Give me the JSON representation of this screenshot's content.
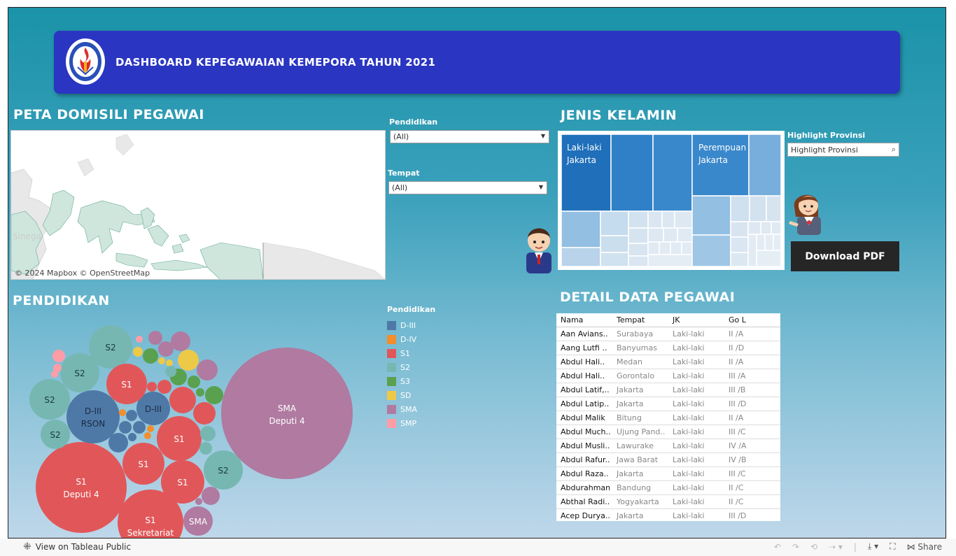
{
  "banner": {
    "title": "DASHBOARD KEPEGAWAIAN KEMEPORA TAHUN 2021",
    "logo_text": "KEMENTERIAN PEMUDA DAN OLAHRAGA REPUBLIK INDONESIA"
  },
  "map_section": {
    "title": "PETA DOMISILI PEGAWAI",
    "credit": "© 2024 Mapbox  © OpenStreetMap",
    "faint_label": "Sinega"
  },
  "filters": {
    "pendidikan": {
      "label": "Pendidikan",
      "value": "(All)"
    },
    "tempat": {
      "label": "Tempat",
      "value": "(All)"
    }
  },
  "gender_section": {
    "title": "JENIS KELAMIN",
    "male_label_1": "Laki-laki",
    "male_label_2": "Jakarta",
    "female_label_1": "Perempuan",
    "female_label_2": "Jakarta"
  },
  "highlight": {
    "label": "Highlight Provinsi",
    "placeholder": "Highlight Provinsi"
  },
  "download_button": "Download PDF",
  "pendidikan_section": {
    "title": "PENDIDIKAN"
  },
  "legend": {
    "title": "Pendidikan",
    "items": [
      {
        "label": "D-III",
        "color": "#4e79a7"
      },
      {
        "label": "D-IV",
        "color": "#f28e2b"
      },
      {
        "label": "S1",
        "color": "#e15759"
      },
      {
        "label": "S2",
        "color": "#76b7b2"
      },
      {
        "label": "S3",
        "color": "#59a14f"
      },
      {
        "label": "SD",
        "color": "#edc948"
      },
      {
        "label": "SMA",
        "color": "#b07aa1"
      },
      {
        "label": "SMP",
        "color": "#ff9da7"
      }
    ]
  },
  "bubble_labels": {
    "sma_big_1": "SMA",
    "sma_big_2": "Deputi 4",
    "s1_big_1": "S1",
    "s1_big_2": "Deputi 4",
    "s1_sek_1": "S1",
    "s1_sek_2": "Sekretariat",
    "d3_rson_1": "D-III",
    "d3_rson_2": "RSON",
    "d3": "D-III",
    "s2": "S2",
    "s1": "S1",
    "sma": "SMA"
  },
  "detail_section": {
    "title": "DETAIL DATA PEGAWAI",
    "columns": [
      "Nama",
      "Tempat",
      "JK",
      "Go L"
    ],
    "rows": [
      [
        "Aan Avians..",
        "Surabaya",
        "Laki-laki",
        "II /A"
      ],
      [
        "Aang Lutfi ..",
        "Banyumas",
        "Laki-laki",
        "II /D"
      ],
      [
        "Abdul Hali..",
        "Medan",
        "Laki-laki",
        "II /A"
      ],
      [
        "Abdul Hali..",
        "Gorontalo",
        "Laki-laki",
        "III /A"
      ],
      [
        "Abdul Latif,..",
        "Jakarta",
        "Laki-laki",
        "III /B"
      ],
      [
        "Abdul Latip..",
        "Jakarta",
        "Laki-laki",
        "III /D"
      ],
      [
        "Abdul Malik",
        "Bitung",
        "Laki-laki",
        "II /A"
      ],
      [
        "Abdul Much..",
        "Ujung Pand..",
        "Laki-laki",
        "III /C"
      ],
      [
        "Abdul Musli..",
        "Lawurake",
        "Laki-laki",
        "IV /A"
      ],
      [
        "Abdul Rafur..",
        "Jawa Barat",
        "Laki-laki",
        "IV /B"
      ],
      [
        "Abdul Raza..",
        "Jakarta",
        "Laki-laki",
        "III /C"
      ],
      [
        "Abdurahman",
        "Bandung",
        "Laki-laki",
        "II /C"
      ],
      [
        "Abthal Radi..",
        "Yogyakarta",
        "Laki-laki",
        "II /C"
      ],
      [
        "Acep Durya..",
        "Jakarta",
        "Laki-laki",
        "III /D"
      ]
    ]
  },
  "toolbar": {
    "view_on": "View on Tableau Public",
    "share": "Share"
  }
}
